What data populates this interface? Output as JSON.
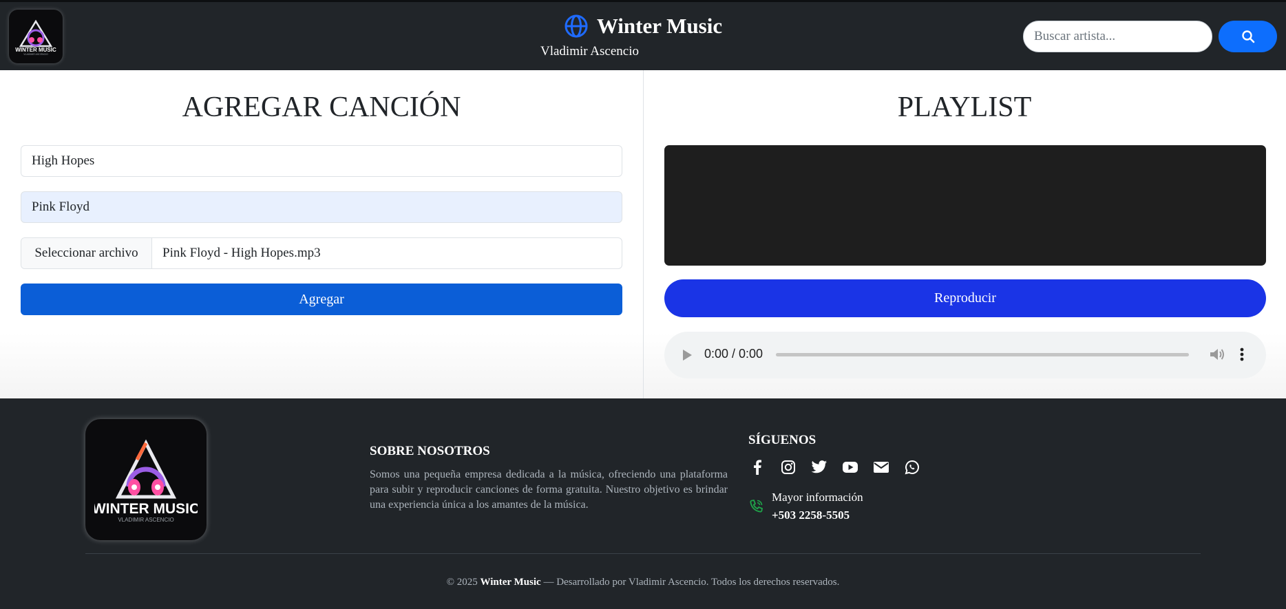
{
  "header": {
    "logo_text": "WINTER MUSIC",
    "logo_subtext": "VLADIMIR ASCENCIO",
    "title": "Winter Music",
    "subtitle": "Vladimir Ascencio",
    "search_placeholder": "Buscar artista..."
  },
  "add_song": {
    "title": "AGREGAR CANCIÓN",
    "song_value": "High Hopes",
    "artist_value": "Pink Floyd",
    "file_button_label": "Seleccionar archivo",
    "file_name": "Pink Floyd - High Hopes.mp3",
    "submit_label": "Agregar"
  },
  "playlist": {
    "title": "PLAYLIST",
    "play_label": "Reproducir",
    "audio_time": "0:00 / 0:00"
  },
  "footer": {
    "logo_text": "WINTER MUSIC",
    "logo_subtext": "VLADIMIR ASCENCIO",
    "about_title": "SOBRE NOSOTROS",
    "about_text": "Somos una pequeña empresa dedicada a la música, ofreciendo una plataforma para subir y reproducir canciones de forma gratuita. Nuestro objetivo es brindar una experiencia única a los amantes de la música.",
    "follow_title": "SÍGUENOS",
    "socials": [
      "facebook-icon",
      "instagram-icon",
      "twitter-icon",
      "youtube-icon",
      "mail-icon",
      "whatsapp-icon"
    ],
    "info_label": "Mayor información",
    "phone": "+503 2258-5505",
    "copyright_prefix": "© 2025",
    "copyright_brand": "Winter Music",
    "copyright_suffix": "— Desarrollado por Vladimir Ascencio. Todos los derechos reservados."
  },
  "colors": {
    "header_bg": "#212529",
    "primary": "#0d6efd",
    "play_button": "#1a34e6",
    "footer_bg": "#212529"
  }
}
